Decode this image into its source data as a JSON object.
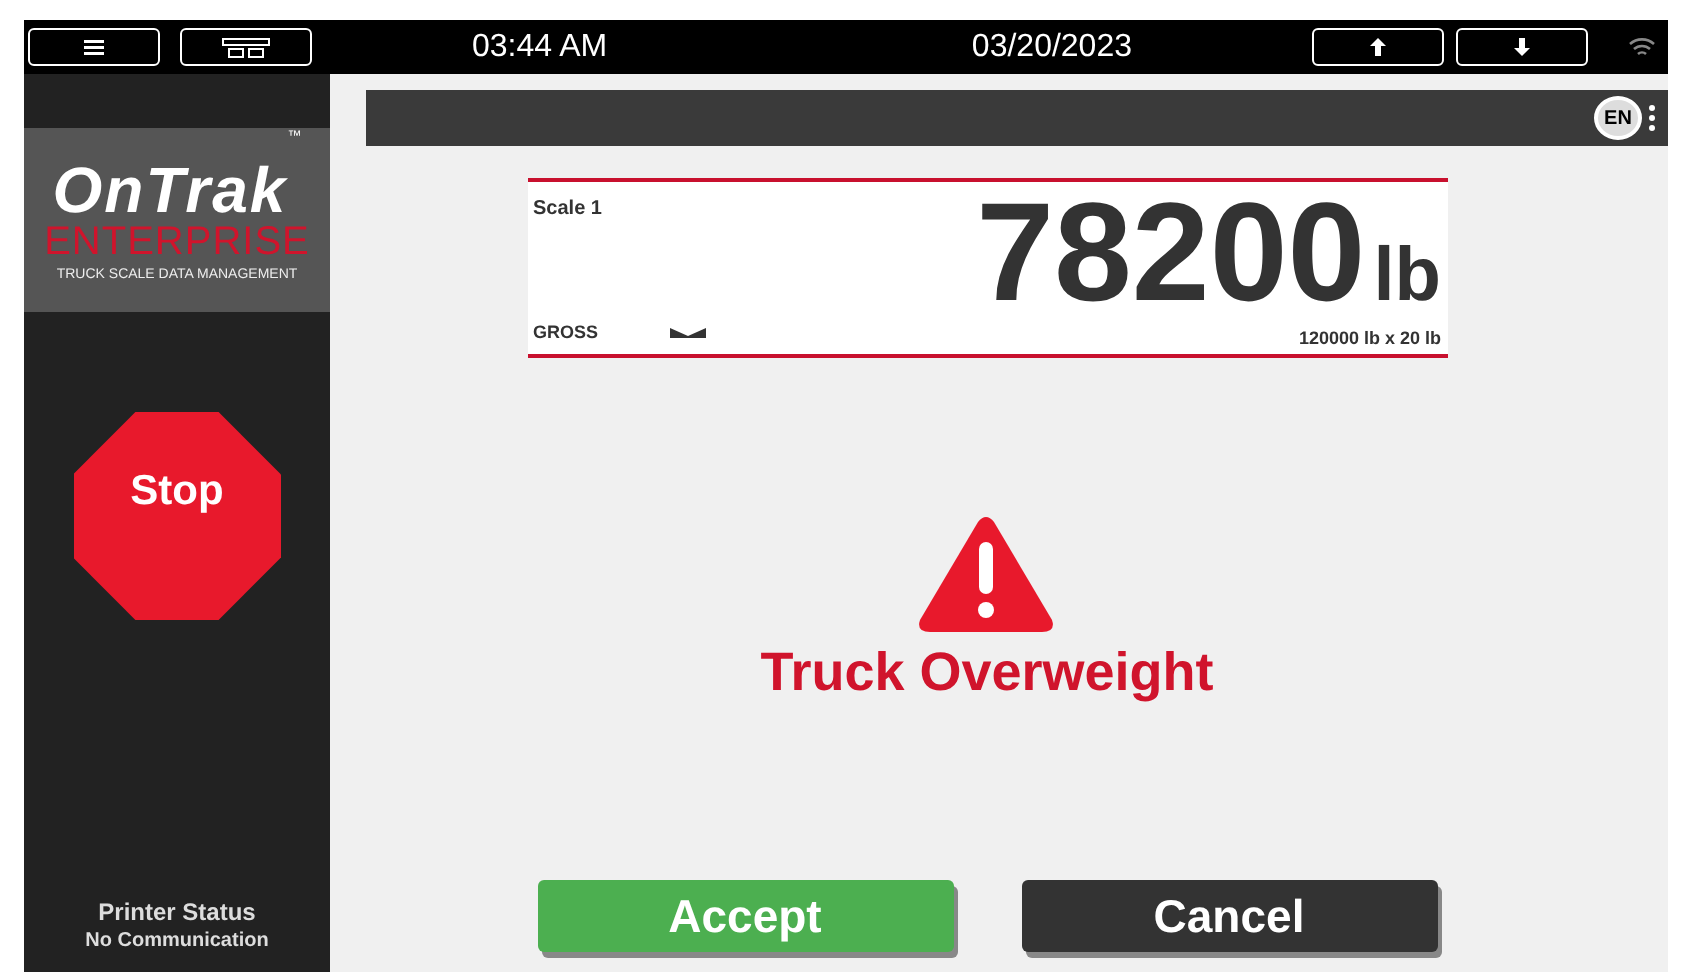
{
  "top_bar": {
    "time": "03:44 AM",
    "date": "03/20/2023"
  },
  "sidebar": {
    "logo": {
      "name": "OnTrak",
      "trademark": "™",
      "subtitle": "ENTERPRISE",
      "tagline": "TRUCK SCALE DATA MANAGEMENT"
    },
    "stop_button": "Stop",
    "printer_status": {
      "label": "Printer Status",
      "value": "No Communication"
    }
  },
  "language": "EN",
  "scale": {
    "name": "Scale 1",
    "weight": "78200",
    "unit": "lb",
    "mode": "GROSS",
    "capacity": "120000 lb x 20 lb"
  },
  "alert": {
    "message": "Truck Overweight"
  },
  "buttons": [
    {
      "label": "Accept",
      "kind": "primary"
    },
    {
      "label": "Cancel",
      "kind": "secondary"
    }
  ]
}
